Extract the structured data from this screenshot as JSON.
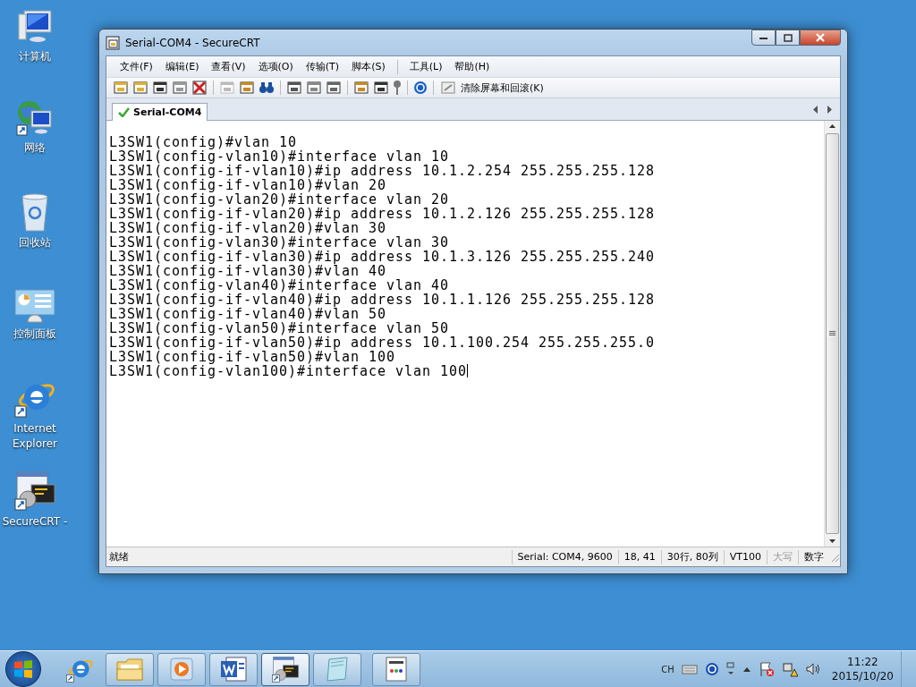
{
  "desktop_icons": [
    {
      "kind": "computer",
      "label": "计算机"
    },
    {
      "kind": "network",
      "label": "网络"
    },
    {
      "kind": "recycle",
      "label": "回收站"
    },
    {
      "kind": "control",
      "label": "控制面板"
    },
    {
      "kind": "ie",
      "label": "Internet Explorer"
    },
    {
      "kind": "securecrt",
      "label": "SecureCRT -"
    }
  ],
  "window": {
    "title": "Serial-COM4 - SecureCRT",
    "menu": [
      "文件(F)",
      "编辑(E)",
      "查看(V)",
      "选项(O)",
      "传输(T)",
      "脚本(S)",
      "工具(L)",
      "帮助(H)"
    ],
    "toolbar": {
      "clear_button": "清除屏幕和回滚(K)"
    },
    "tabs": [
      {
        "label": "Serial-COM4",
        "selected": true,
        "connected": true
      }
    ],
    "terminal_lines": [
      "L3SW1(config)#vlan 10",
      "L3SW1(config-vlan10)#interface vlan 10",
      "L3SW1(config-if-vlan10)#ip address 10.1.2.254 255.255.255.128",
      "L3SW1(config-if-vlan10)#vlan 20",
      "L3SW1(config-vlan20)#interface vlan 20",
      "L3SW1(config-if-vlan20)#ip address 10.1.2.126 255.255.255.128",
      "L3SW1(config-if-vlan20)#vlan 30",
      "L3SW1(config-vlan30)#interface vlan 30",
      "L3SW1(config-if-vlan30)#ip address 10.1.3.126 255.255.255.240",
      "L3SW1(config-if-vlan30)#vlan 40",
      "L3SW1(config-vlan40)#interface vlan 40",
      "L3SW1(config-if-vlan40)#ip address 10.1.1.126 255.255.255.128",
      "L3SW1(config-if-vlan40)#vlan 50",
      "L3SW1(config-vlan50)#interface vlan 50",
      "L3SW1(config-if-vlan50)#ip address 10.1.100.254 255.255.255.0",
      "L3SW1(config-if-vlan50)#vlan 100",
      "L3SW1(config-vlan100)#interface vlan 100"
    ],
    "status_bar": [
      {
        "text": "就绪",
        "disabled": false
      },
      {
        "text": "Serial: COM4, 9600",
        "disabled": false
      },
      {
        "text": "18,  41",
        "disabled": false
      },
      {
        "text": "30行, 80列",
        "disabled": false
      },
      {
        "text": "VT100",
        "disabled": false
      },
      {
        "text": "大写",
        "disabled": true
      },
      {
        "text": "数字",
        "disabled": false
      }
    ]
  },
  "taskbar": {
    "apps": [
      {
        "kind": "folder",
        "selected": false
      },
      {
        "kind": "media",
        "selected": false
      },
      {
        "kind": "word",
        "selected": false
      },
      {
        "kind": "securecrt",
        "selected": true
      },
      {
        "kind": "notepad",
        "selected": false
      },
      {
        "kind": "document",
        "selected": false
      }
    ],
    "language": "CH",
    "time": "11:22",
    "date": "2015/10/20"
  }
}
